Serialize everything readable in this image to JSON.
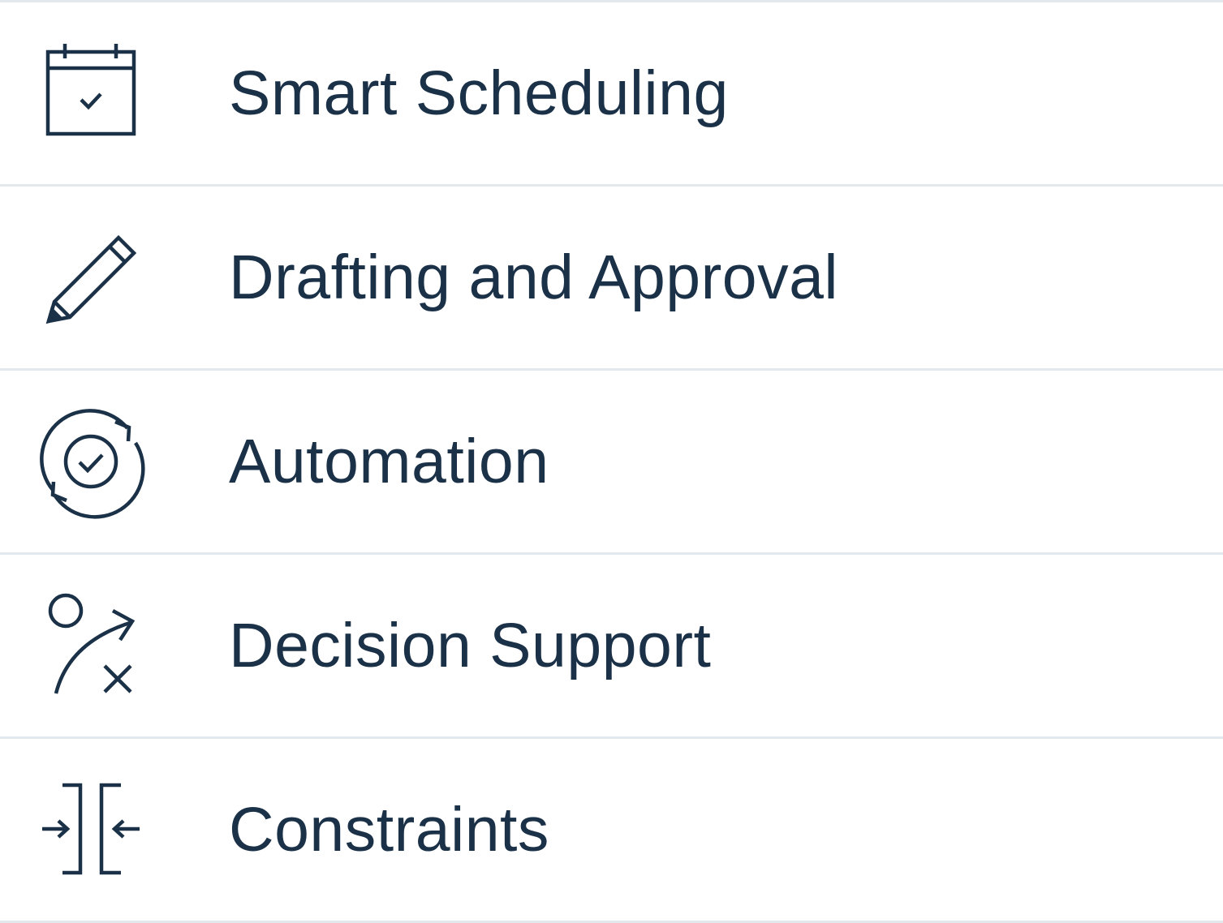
{
  "features": [
    {
      "label": "Smart Scheduling",
      "icon": "calendar-check-icon"
    },
    {
      "label": "Drafting and Approval",
      "icon": "pencil-icon"
    },
    {
      "label": "Automation",
      "icon": "refresh-check-icon"
    },
    {
      "label": "Decision Support",
      "icon": "strategy-play-icon"
    },
    {
      "label": "Constraints",
      "icon": "arrows-to-bracket-icon"
    }
  ],
  "colors": {
    "text": "#1a3148",
    "divider": "#e3e8ed",
    "background": "#ffffff"
  }
}
